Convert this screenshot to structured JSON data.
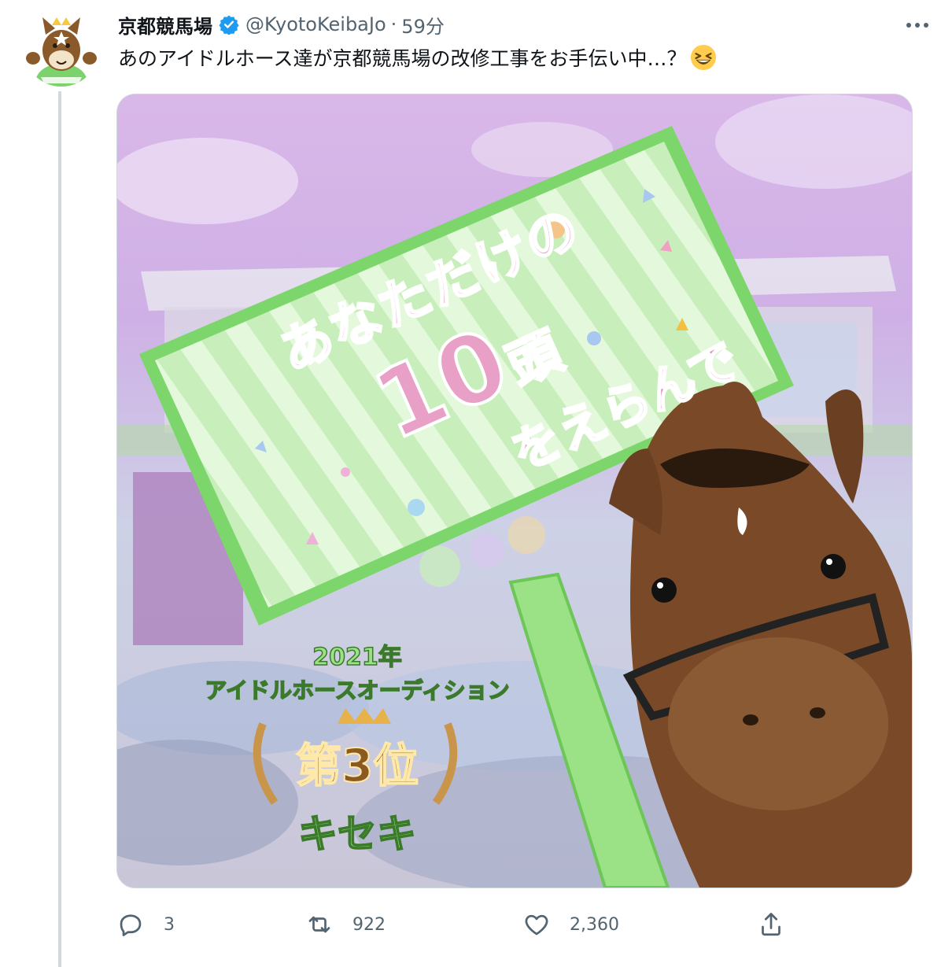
{
  "tweet": {
    "display_name": "京都競馬場",
    "handle": "@KyotoKeibaJo",
    "separator": "·",
    "time": "59分",
    "text": "あのアイドルホース達が京都競馬場の改修工事をお手伝い中…？",
    "emoji_name": "grinning-squinting-face"
  },
  "media": {
    "sign_line1": "あなただけの",
    "sign_number": "10",
    "sign_counter": "頭",
    "sign_line3": "をえらんで",
    "badge_year": "2021年",
    "badge_title": "アイドルホースオーディション",
    "badge_rank": "第3位",
    "badge_name": "キセキ"
  },
  "actions": {
    "reply_count": "3",
    "retweet_count": "922",
    "like_count": "2,360"
  },
  "colors": {
    "verified_blue": "#1d9bf0",
    "muted_text": "#536471",
    "sign_green": "#8fd97c",
    "sign_pink": "#e58fb4"
  }
}
